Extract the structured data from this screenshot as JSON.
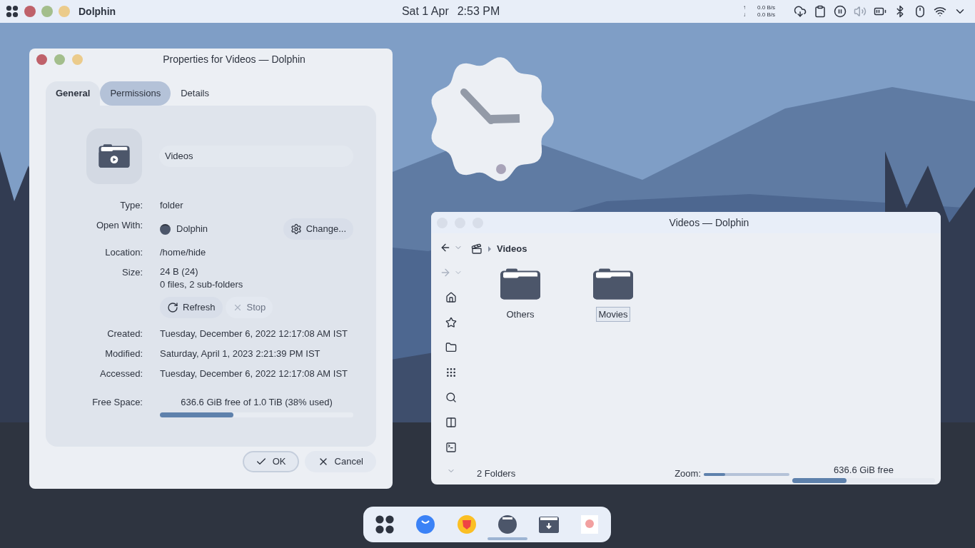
{
  "top_bar": {
    "app_name": "Dolphin",
    "date": "Sat 1 Apr",
    "time": "2:53 PM",
    "net_up_arrow": "↑",
    "net_up": "0.0 B/s",
    "net_down_arrow": "↓",
    "net_down": "0.0 B/s"
  },
  "properties_window": {
    "title": "Properties for Videos — Dolphin",
    "tabs": [
      {
        "label": "General",
        "selected": true,
        "hovered": false
      },
      {
        "label": "Permissions",
        "selected": false,
        "hovered": true
      },
      {
        "label": "Details",
        "selected": false,
        "hovered": false
      }
    ],
    "name": "Videos",
    "rows": [
      {
        "kind": "text",
        "label": "Type:",
        "value": "folder"
      },
      {
        "kind": "app",
        "label": "Open With:",
        "value": "Dolphin",
        "button": "Change..."
      },
      {
        "kind": "text",
        "label": "Location:",
        "value": "/home/hide"
      },
      {
        "kind": "size",
        "label": "Size:",
        "value": "24 B (24)",
        "detail": "0 files, 2 sub-folders",
        "buttons": [
          {
            "label": "Refresh",
            "disabled": false
          },
          {
            "label": "Stop",
            "disabled": true
          }
        ]
      },
      {
        "kind": "text",
        "label": "Created:",
        "value": "Tuesday, December 6, 2022 12:17:08 AM IST"
      },
      {
        "kind": "text",
        "label": "Modified:",
        "value": "Saturday, April 1, 2023 2:21:39 PM IST"
      },
      {
        "kind": "text",
        "label": "Accessed:",
        "value": "Tuesday, December 6, 2022 12:17:08 AM IST"
      },
      {
        "kind": "meter",
        "label": "Free Space:",
        "value": "636.6 GiB free of 1.0 TiB (38% used)",
        "level": 0.38
      }
    ],
    "buttons": [
      {
        "label": "OK",
        "focused": true
      },
      {
        "label": "Cancel",
        "focused": false
      }
    ]
  },
  "dolphin_window": {
    "title": "Videos — Dolphin",
    "back_enabled": true,
    "forward_enabled": false,
    "breadcrumb": "Videos",
    "items": [
      {
        "name": "Others",
        "focused": false
      },
      {
        "name": "Movies",
        "focused": true
      }
    ],
    "status": "2 Folders",
    "zoom_label": "Zoom:",
    "zoom": {
      "level": 0.25
    },
    "free_space": "636.6 GiB free",
    "free_meter": {
      "level": 0.38
    }
  },
  "dock": {
    "items": [
      {
        "kind": "launcher",
        "active": false
      },
      {
        "kind": "blue",
        "active": false
      },
      {
        "kind": "browser",
        "active": false
      },
      {
        "kind": "dolphin",
        "active": true
      },
      {
        "kind": "downloads",
        "active": false
      },
      {
        "kind": "image",
        "active": false
      }
    ]
  }
}
